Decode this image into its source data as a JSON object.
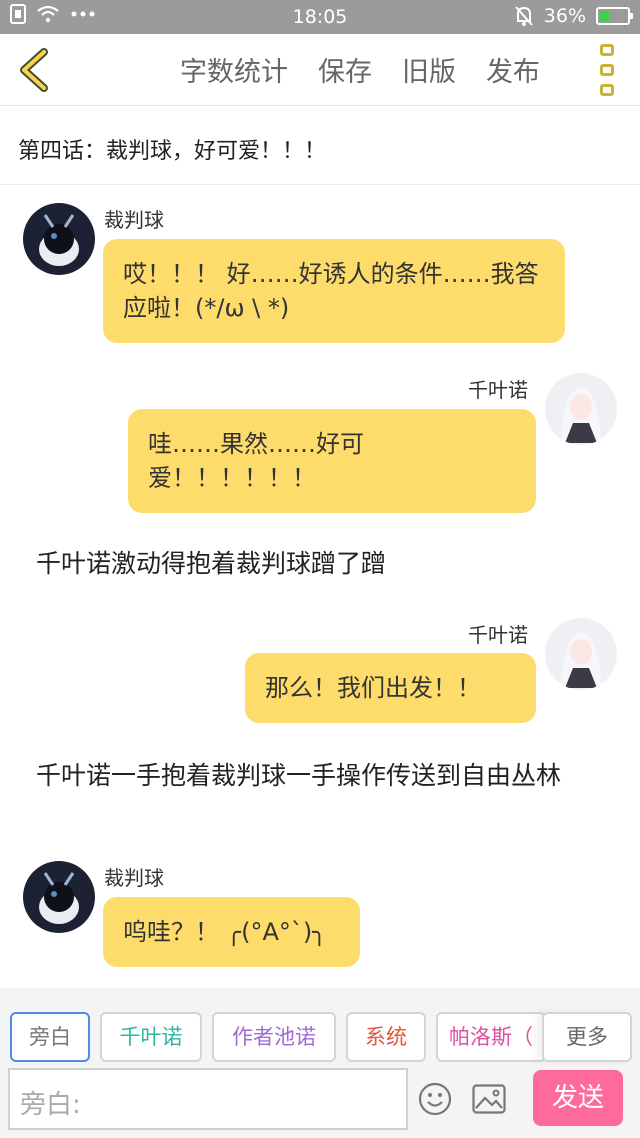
{
  "status_bar": {
    "time": "18:05",
    "battery": "36%",
    "battery_level": 0.36,
    "icons": [
      "sim-icon",
      "wifi-icon",
      "more-dots-icon",
      "mute-bell-icon",
      "battery-icon"
    ]
  },
  "nav": {
    "back_icon": "chevron-left-icon",
    "actions": {
      "word_count": "字数统计",
      "save": "保存",
      "old_version": "旧版",
      "publish": "发布"
    },
    "menu_icon": "menu-icon"
  },
  "chapter": {
    "title": "第四话：裁判球，好可爱！！！"
  },
  "messages": [
    {
      "type": "bubble",
      "side": "left",
      "sender": "裁判球",
      "text": "哎！！！ 好……好诱人的条件……我答应啦！(*/ω \\ *)"
    },
    {
      "type": "bubble",
      "side": "right",
      "sender": "千叶诺",
      "text": "哇……果然……好可爱！！！！！！"
    },
    {
      "type": "narration",
      "text": "千叶诺激动得抱着裁判球蹭了蹭"
    },
    {
      "type": "bubble",
      "side": "right",
      "sender": "千叶诺",
      "text": "那么！我们出发！！"
    },
    {
      "type": "narration",
      "text": "千叶诺一手抱着裁判球一手操作传送到自由丛林"
    },
    {
      "type": "bubble",
      "side": "left",
      "sender": "裁判球",
      "text": "呜哇？！ ╭(°A°`)╮"
    }
  ],
  "roles": {
    "items": [
      {
        "label": "旁白",
        "color": "#777777",
        "active": true
      },
      {
        "label": "千叶诺",
        "color": "#2bb5a0",
        "active": false
      },
      {
        "label": "作者池诺",
        "color": "#a36bd1",
        "active": false
      },
      {
        "label": "系统",
        "color": "#e4553a",
        "active": false
      },
      {
        "label": "帕洛斯（",
        "color": "#e04ea0",
        "active": false
      }
    ],
    "more_label": "更多"
  },
  "composer": {
    "placeholder": "旁白:",
    "emoji_icon": "emoji-icon",
    "image_icon": "image-icon",
    "send_label": "发送"
  },
  "colors": {
    "bubble": "#fddc6c",
    "send_button": "#ff6a9c",
    "active_role_border": "#4c8ddd",
    "status_bar": "#9b9b9b"
  }
}
